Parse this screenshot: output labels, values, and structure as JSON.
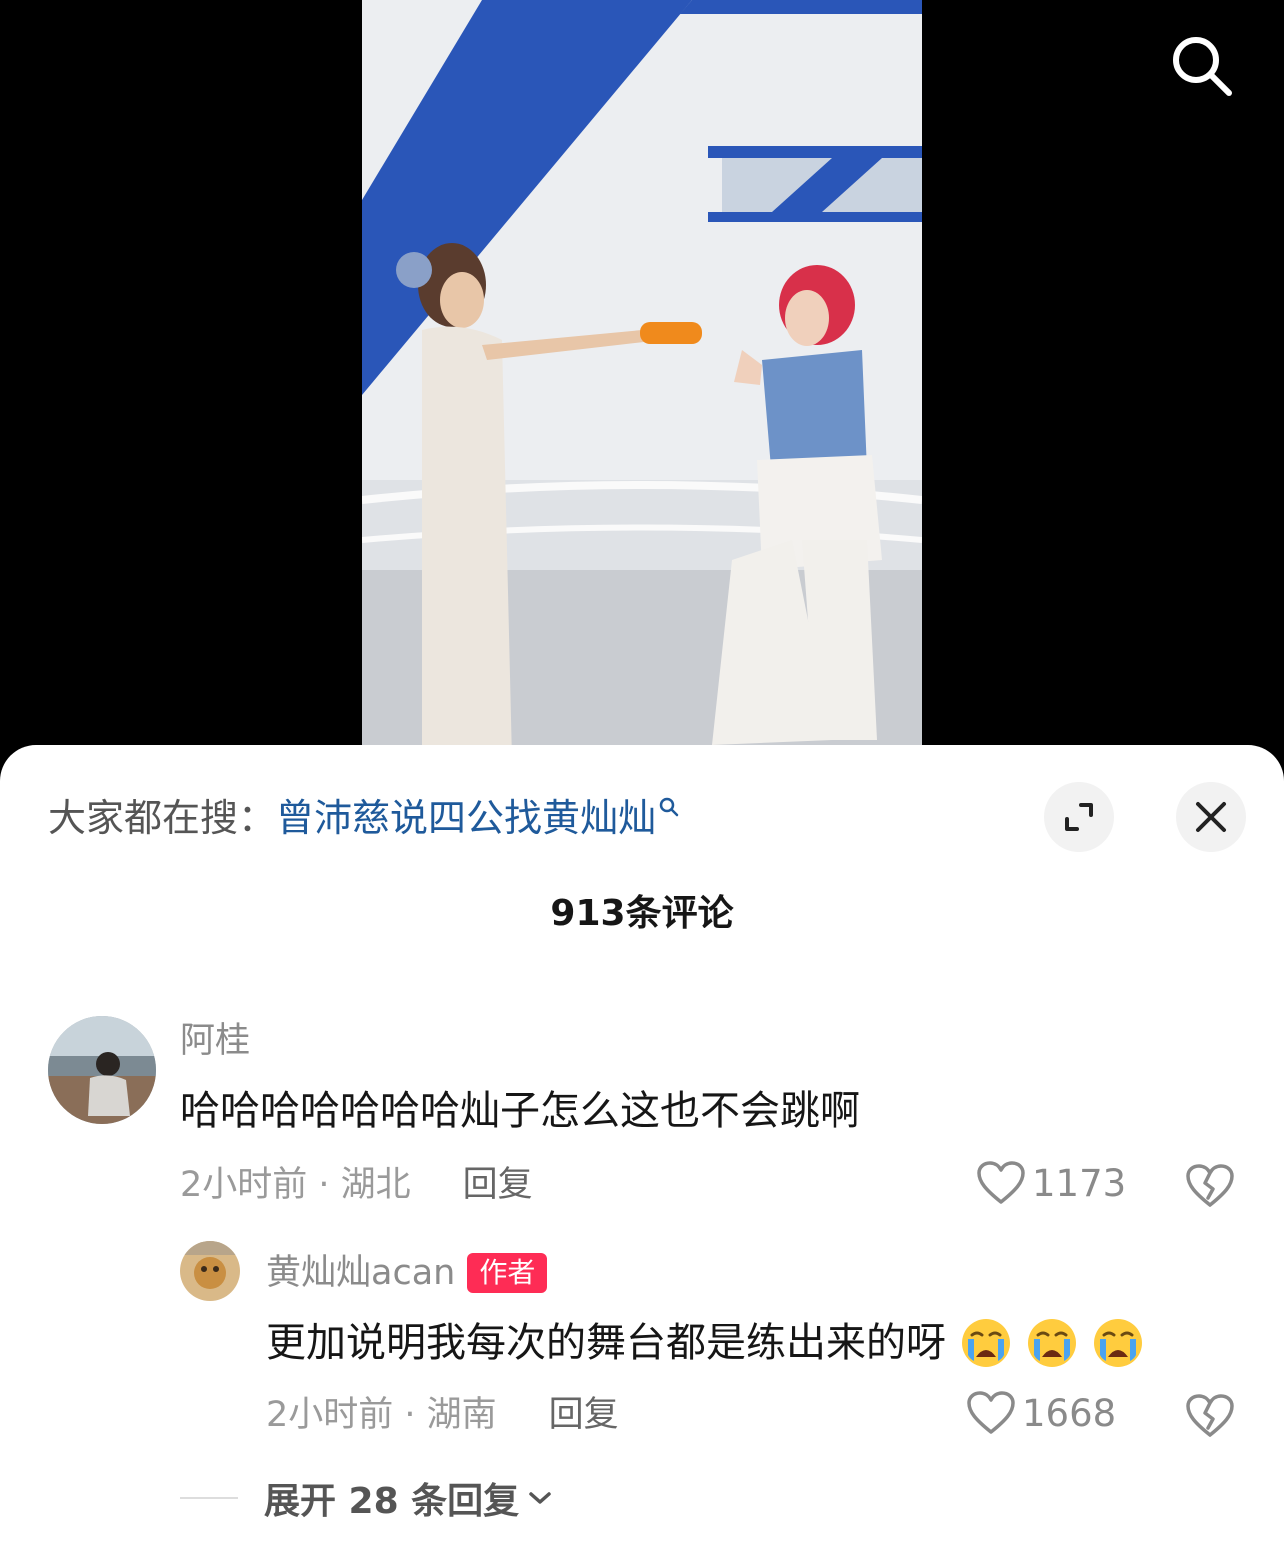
{
  "video": {
    "background_color": "#000000",
    "accent_blue": "#2a56b8"
  },
  "trending": {
    "label": "大家都在搜：",
    "query": "曾沛慈说四公找黄灿灿"
  },
  "comments_header": {
    "count_text": "913条评论"
  },
  "comments": [
    {
      "username": "阿桂",
      "text": "哈哈哈哈哈哈哈灿子怎么这也不会跳啊",
      "time": "2小时前 · 湖北",
      "reply_label": "回复",
      "likes": "1173"
    }
  ],
  "reply": {
    "username": "黄灿灿acan",
    "badge": "作者",
    "text": "更加说明我每次的舞台都是练出来的呀",
    "emoji_name": "loudly-crying-face-icon",
    "emoji_count": 3,
    "time": "2小时前 · 湖南",
    "reply_label": "回复",
    "likes": "1668"
  },
  "expand_replies": {
    "label": "展开 28 条回复"
  },
  "colors": {
    "link_blue": "#1f5a9b",
    "badge_red": "#fe2c55"
  }
}
